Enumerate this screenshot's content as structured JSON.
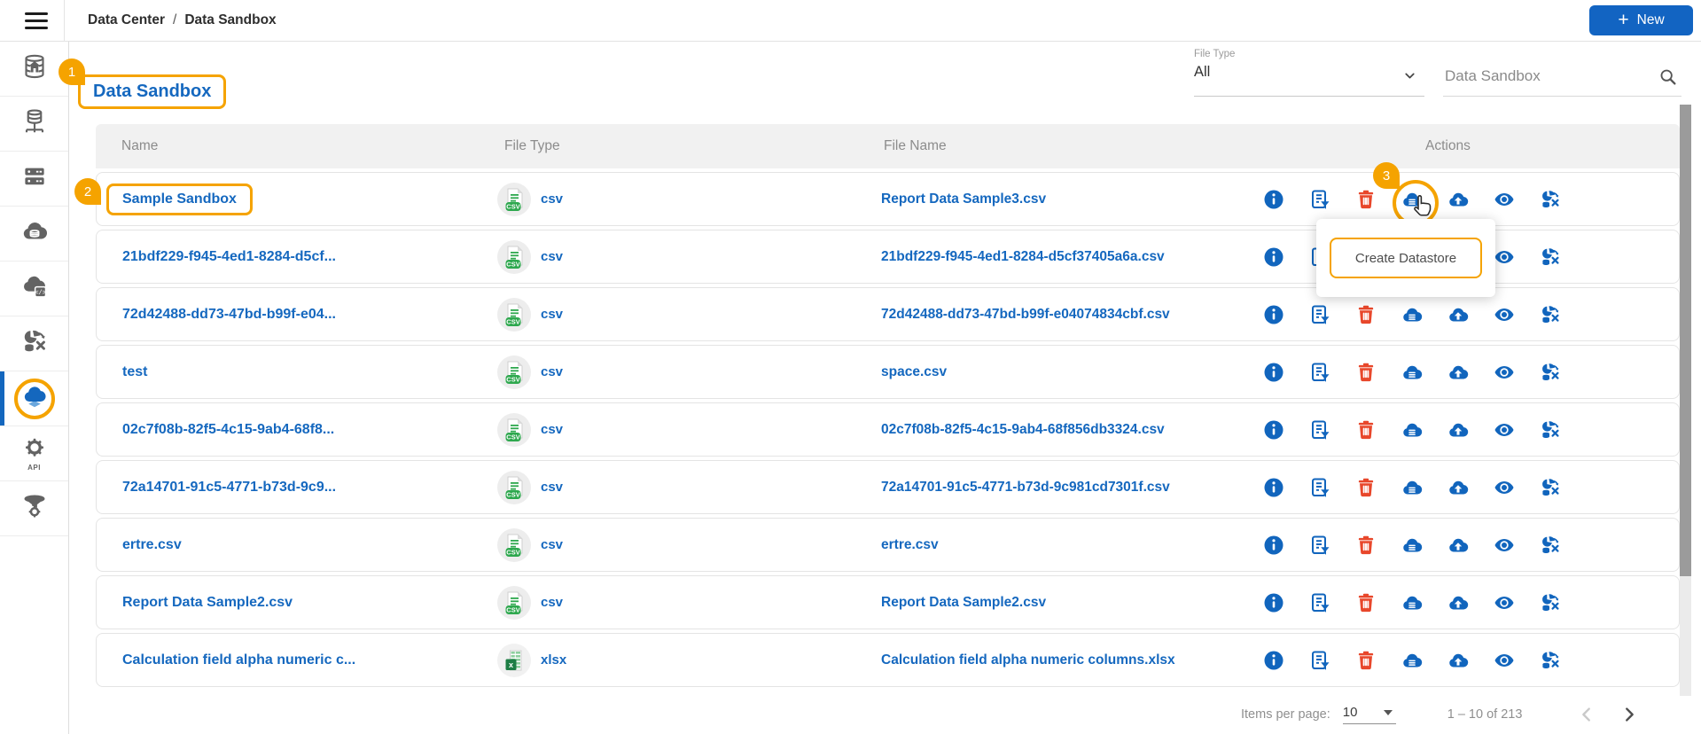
{
  "topbar": {
    "breadcrumb": {
      "root": "Data Center",
      "separator": "/",
      "current": "Data Sandbox"
    },
    "new_button": {
      "icon": "+",
      "label": "New"
    }
  },
  "sidebar": {
    "items": [
      {
        "icon": "database-home"
      },
      {
        "icon": "database-network"
      },
      {
        "icon": "server-rack"
      },
      {
        "icon": "cloud-database"
      },
      {
        "icon": "cloud-database-code"
      },
      {
        "icon": "data-transform"
      },
      {
        "icon": "data-sandbox-cloud",
        "active": true
      },
      {
        "icon": "api-gear",
        "label": "API"
      },
      {
        "icon": "pipeline-funnel"
      }
    ]
  },
  "page": {
    "title": "Data Sandbox"
  },
  "filters": {
    "file_type": {
      "label": "File Type",
      "value": "All"
    },
    "search": {
      "value": "Data Sandbox"
    }
  },
  "annotations": {
    "step1": "1",
    "step2": "2",
    "step3": "3",
    "tooltip": "Create Datastore"
  },
  "table": {
    "columns": [
      "Name",
      "File Type",
      "File Name",
      "Actions"
    ],
    "actions": [
      "info",
      "copy-rules",
      "delete",
      "create-datastore",
      "upload",
      "preview",
      "data-sync"
    ],
    "rows": [
      {
        "name": "Sample Sandbox",
        "file_type": "csv",
        "file_name": "Report Data Sample3.csv",
        "callout": true,
        "highlight": "create-datastore"
      },
      {
        "name": "21bdf229-f945-4ed1-8284-d5cf...",
        "file_type": "csv",
        "file_name": "21bdf229-f945-4ed1-8284-d5cf37405a6a.csv"
      },
      {
        "name": "72d42488-dd73-47bd-b99f-e04...",
        "file_type": "csv",
        "file_name": "72d42488-dd73-47bd-b99f-e04074834cbf.csv"
      },
      {
        "name": "test",
        "file_type": "csv",
        "file_name": "space.csv"
      },
      {
        "name": "02c7f08b-82f5-4c15-9ab4-68f8...",
        "file_type": "csv",
        "file_name": "02c7f08b-82f5-4c15-9ab4-68f856db3324.csv"
      },
      {
        "name": "72a14701-91c5-4771-b73d-9c9...",
        "file_type": "csv",
        "file_name": "72a14701-91c5-4771-b73d-9c981cd7301f.csv"
      },
      {
        "name": "ertre.csv",
        "file_type": "csv",
        "file_name": "ertre.csv"
      },
      {
        "name": "Report Data Sample2.csv",
        "file_type": "csv",
        "file_name": "Report Data Sample2.csv"
      },
      {
        "name": "Calculation field alpha numeric c...",
        "file_type": "xlsx",
        "file_name": "Calculation field alpha numeric columns.xlsx"
      }
    ]
  },
  "pagination": {
    "label": "Items per page:",
    "value": "10",
    "range": "1 – 10 of 213"
  },
  "colors": {
    "accent_orange": "#F5A300",
    "link_blue": "#1568bf",
    "icon_blue": "#1165bd",
    "button_blue": "#1264c2",
    "delete_red": "#E8472B",
    "csv_green": "#2EA84E"
  }
}
